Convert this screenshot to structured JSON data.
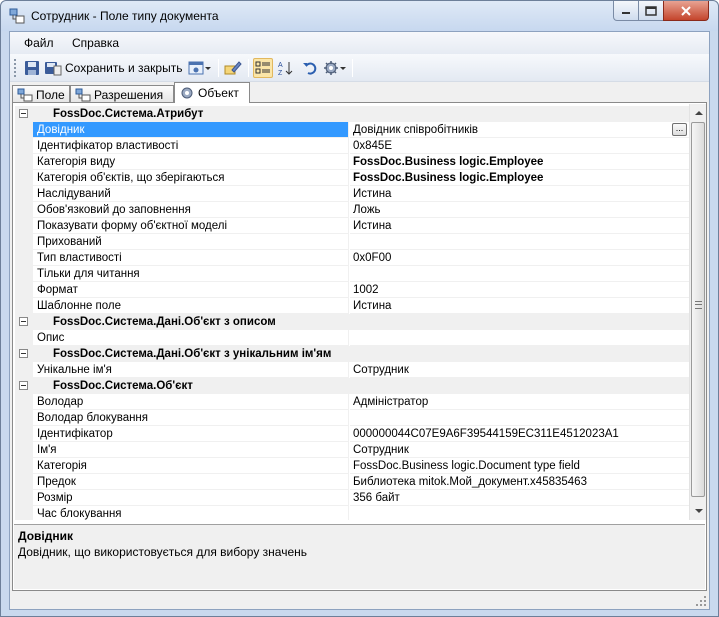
{
  "window": {
    "title": "Сотрудник - Поле типу документа"
  },
  "menu": {
    "file": "Файл",
    "help": "Справка"
  },
  "toolbar": {
    "save_close_label": "Сохранить и закрыть"
  },
  "tabs": [
    {
      "label": "Поле"
    },
    {
      "label": "Разрешения"
    },
    {
      "label": "Объект"
    }
  ],
  "grid": {
    "cat_attr": "FossDoc.Система.Атрибут",
    "r_dovidnyk": {
      "name": "Довідник",
      "value": "Довідник співробітників"
    },
    "r_id": {
      "name": "Ідентифікатор властивості",
      "value": "0x845E"
    },
    "r_kat_vydu": {
      "name": "Категорія виду",
      "value": "FossDoc.Business logic.Employee"
    },
    "r_kat_obj": {
      "name": "Категорія об'єктів, що зберігаються",
      "value": "FossDoc.Business logic.Employee"
    },
    "r_nasl": {
      "name": "Наслідуваний",
      "value": "Истина"
    },
    "r_oboviaz": {
      "name": "Обов'язковий до заповнення",
      "value": "Ложь"
    },
    "r_pokaz": {
      "name": "Показувати форму об'єктної моделі",
      "value": "Истина"
    },
    "r_prykh": {
      "name": "Прихований",
      "value": ""
    },
    "r_typ": {
      "name": "Тип властивості",
      "value": "0x0F00"
    },
    "r_tilky": {
      "name": "Тільки для читання",
      "value": ""
    },
    "r_format": {
      "name": "Формат",
      "value": "1002"
    },
    "r_shabl": {
      "name": "Шаблонне поле",
      "value": "Истина"
    },
    "cat_opys": "FossDoc.Система.Дані.Об'єкт з описом",
    "r_opys": {
      "name": "Опис",
      "value": ""
    },
    "cat_unik": "FossDoc.Система.Дані.Об'єкт з унікальним ім'ям",
    "r_unik": {
      "name": "Унікальне ім'я",
      "value": "Сотрудник"
    },
    "cat_obj": "FossDoc.Система.Об'єкт",
    "r_volodar": {
      "name": "Володар",
      "value": "Адміністратор"
    },
    "r_vol_blok": {
      "name": "Володар блокування",
      "value": ""
    },
    "r_ident": {
      "name": "Ідентифікатор",
      "value": "000000044C07E9A6F39544159EC311E4512023A1"
    },
    "r_imia": {
      "name": "Ім'я",
      "value": "Сотрудник"
    },
    "r_kateg": {
      "name": "Категорія",
      "value": "FossDoc.Business logic.Document type field"
    },
    "r_predok": {
      "name": "Предок",
      "value": "Библиотека mitok.Мой_документ.x45835463"
    },
    "r_rozmir": {
      "name": "Розмір",
      "value": "356 байт"
    },
    "r_chas": {
      "name": "Час блокування",
      "value": ""
    }
  },
  "description": {
    "title": "Довідник",
    "text": "Довідник, що використовується для вибору значень"
  }
}
